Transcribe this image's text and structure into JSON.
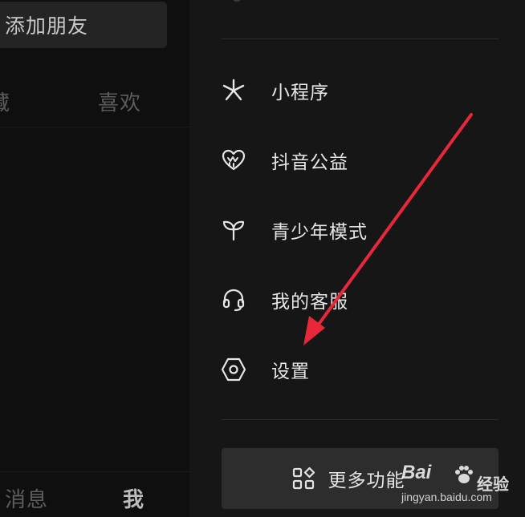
{
  "left_page": {
    "add_friend_label": "添加朋友",
    "tabs": [
      {
        "label": "藏"
      },
      {
        "label": "喜欢"
      }
    ],
    "bottom_nav": [
      {
        "label": "消息"
      },
      {
        "label": "我"
      }
    ]
  },
  "drawer": {
    "menu_items": [
      {
        "label": "小程序",
        "icon": "mini-program-icon"
      },
      {
        "label": "抖音公益",
        "icon": "charity-heart-icon"
      },
      {
        "label": "青少年模式",
        "icon": "sprout-icon"
      },
      {
        "label": "我的客服",
        "icon": "headset-icon"
      },
      {
        "label": "设置",
        "icon": "hexagon-settings-icon"
      }
    ],
    "more_button": {
      "label": "更多功能",
      "icon": "grid-apps-icon"
    }
  },
  "annotation": {
    "arrow_color": "#e8283a",
    "points_to": "设置"
  },
  "watermark": {
    "brand": "Bai",
    "brand_suffix": "经验",
    "url": "jingyan.baidu.com"
  },
  "colors": {
    "background": "#0b0b0b",
    "drawer_bg": "#161616",
    "text_primary": "#e6e6e6",
    "text_dim": "#5b5b5b",
    "button_bg": "#2d2d2d"
  }
}
